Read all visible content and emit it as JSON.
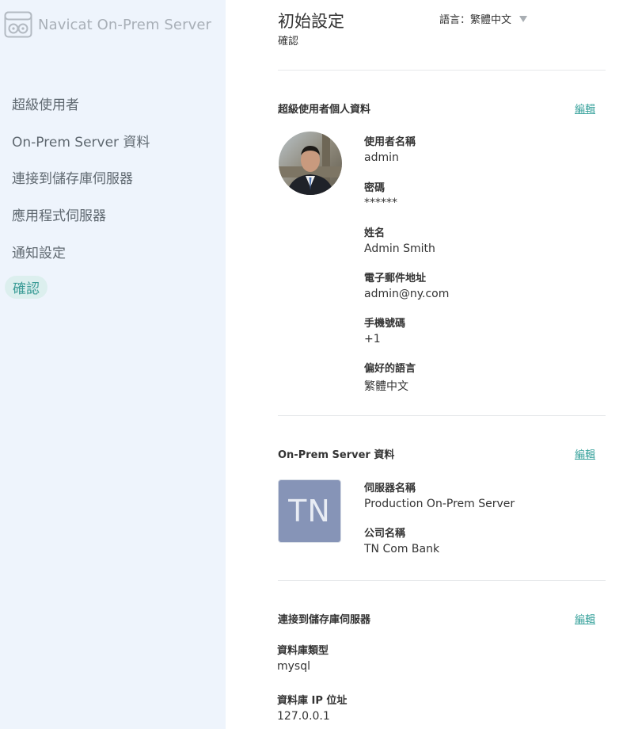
{
  "app": {
    "name": "Navicat On-Prem Server"
  },
  "sidebar": {
    "items": [
      {
        "label": "超級使用者"
      },
      {
        "label": "On-Prem Server 資料"
      },
      {
        "label": "連接到儲存庫伺服器"
      },
      {
        "label": "應用程式伺服器"
      },
      {
        "label": "通知設定"
      },
      {
        "label": "確認",
        "active": true
      }
    ]
  },
  "header": {
    "title": "初始設定",
    "subtitle": "確認",
    "language_label": "語言：繁體中文"
  },
  "superuser": {
    "title": "超級使用者個人資料",
    "edit_label": "編輯",
    "fields": [
      {
        "label": "使用者名稱",
        "value": "admin"
      },
      {
        "label": "密碼",
        "value": "******"
      },
      {
        "label": "姓名",
        "value": "Admin Smith"
      },
      {
        "label": "電子郵件地址",
        "value": "admin@ny.com"
      },
      {
        "label": "手機號碼",
        "value": "+1"
      },
      {
        "label": "偏好的語言",
        "value": "繁體中文"
      }
    ]
  },
  "server": {
    "title": "On-Prem Server 資料",
    "edit_label": "編輯",
    "initials": "TN",
    "fields": [
      {
        "label": "伺服器名稱",
        "value": "Production On-Prem Server"
      },
      {
        "label": "公司名稱",
        "value": "TN Com Bank"
      }
    ]
  },
  "repository": {
    "title": "連接到儲存庫伺服器",
    "edit_label": "編輯",
    "fields": [
      {
        "label": "資料庫類型",
        "value": "mysql"
      },
      {
        "label": "資料庫 IP 位址",
        "value": "127.0.0.1"
      }
    ]
  },
  "colors": {
    "accent": "#3aa39d",
    "sidebar_bg": "#eef4fc",
    "tile_bg": "#8694b7"
  }
}
